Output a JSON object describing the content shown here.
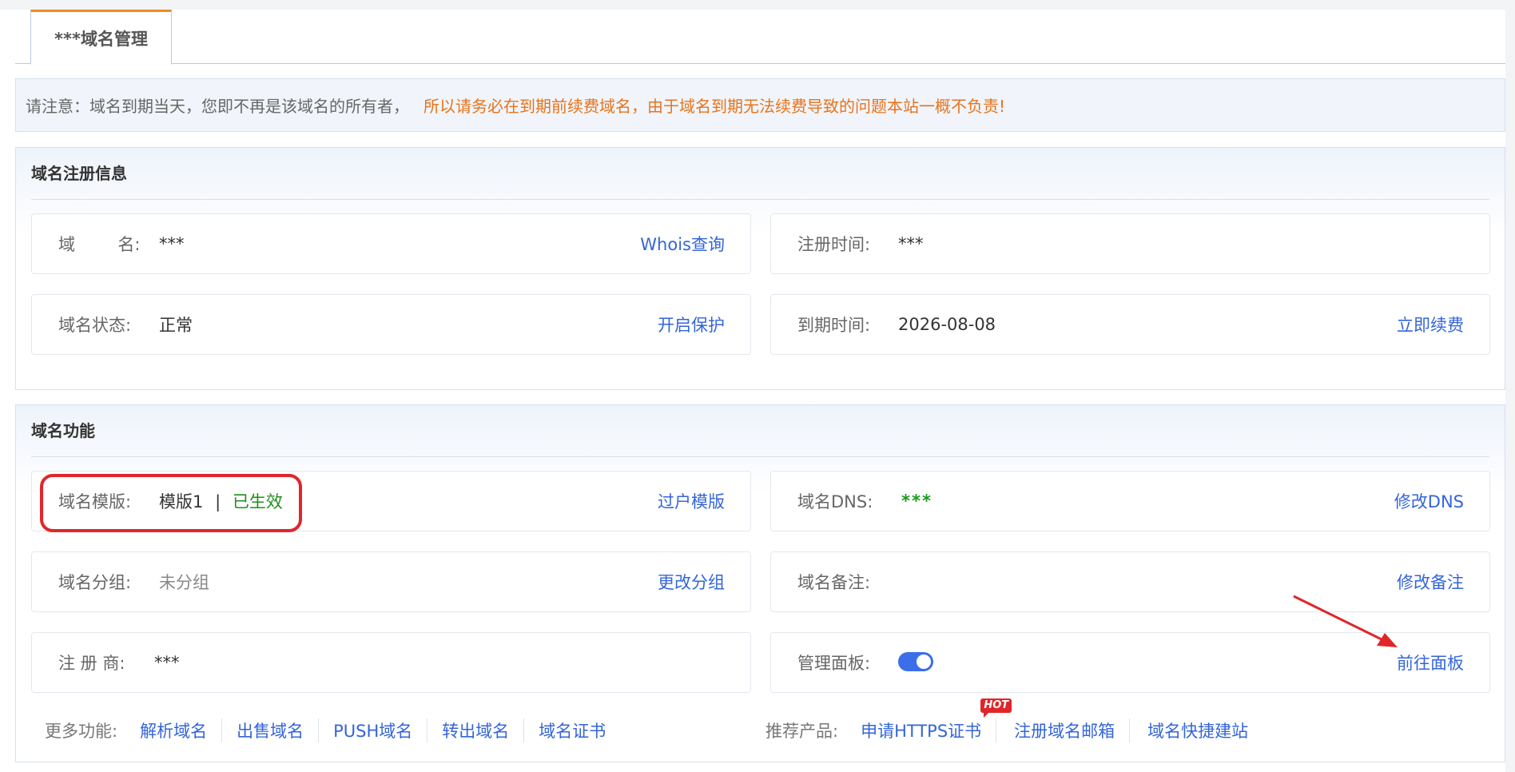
{
  "tab": {
    "label": "***域名管理"
  },
  "notice": {
    "prefix": "请注意：域名到期当天，您即不再是该域名的所有者，",
    "warning": "所以请务必在到期前续费域名，由于域名到期无法续费导致的问题本站一概不负责!"
  },
  "registration": {
    "title": "域名注册信息",
    "domain": {
      "label": "域        名:",
      "value": "***",
      "action": "Whois查询"
    },
    "reg_time": {
      "label": "注册时间:",
      "value": "***"
    },
    "status": {
      "label": "域名状态:",
      "value": "正常",
      "action": "开启保护"
    },
    "expire": {
      "label": "到期时间:",
      "value": "2026-08-08",
      "action": "立即续费"
    }
  },
  "features": {
    "title": "域名功能",
    "template": {
      "label": "域名模版:",
      "value": "模版1",
      "separator": "|",
      "status": "已生效",
      "action": "过户模版"
    },
    "dns": {
      "label": "域名DNS:",
      "value": "***",
      "action": "修改DNS"
    },
    "group": {
      "label": "域名分组:",
      "value": "未分组",
      "action": "更改分组"
    },
    "note": {
      "label": "域名备注:",
      "value": "",
      "action": "修改备注"
    },
    "registrar": {
      "label": "注 册 商:",
      "value": "***"
    },
    "panel": {
      "label": "管理面板:",
      "toggle_on": true,
      "action": "前往面板"
    }
  },
  "more": {
    "label": "更多功能:",
    "links": [
      "解析域名",
      "出售域名",
      "PUSH域名",
      "转出域名",
      "域名证书"
    ]
  },
  "recommend": {
    "label": "推荐产品:",
    "links": [
      "申请HTTPS证书",
      "注册域名邮箱",
      "域名快捷建站"
    ],
    "hot_badge": "HOT"
  },
  "colors": {
    "accent": "#3465d9",
    "warning": "#e8731c",
    "tab_border": "#f08a24",
    "success": "#1a9a1a",
    "highlight": "#e0262b"
  }
}
